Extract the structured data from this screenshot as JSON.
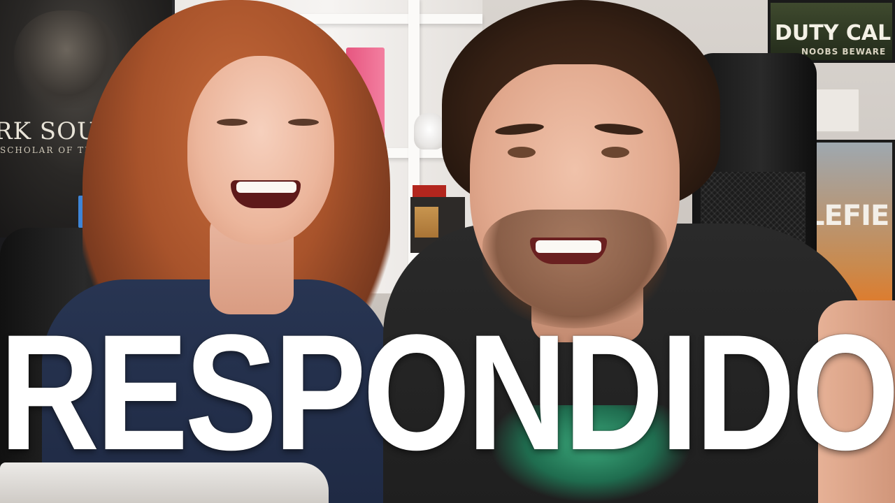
{
  "thumbnail": {
    "headline": "RESPONDIDO"
  },
  "background": {
    "poster_left_title": "RK SOULS",
    "poster_left_subtitle": "SCHOLAR OF THE FIRS",
    "poster_top_right_title": "DUTY CAL",
    "poster_top_right_subtitle": "NOOBS BEWARE",
    "poster_right_title": "LEFIE"
  },
  "colors": {
    "headline_text": "#ffffff",
    "shirt_graphic": "#3fbf8a"
  }
}
